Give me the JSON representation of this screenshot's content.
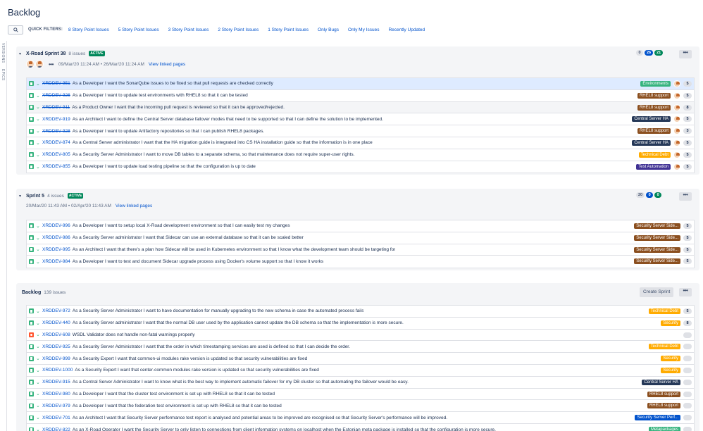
{
  "page": {
    "title": "Backlog"
  },
  "filters": {
    "label": "QUICK FILTERS:",
    "items": [
      "8 Story Point Issues",
      "5 Story Point Issues",
      "3 Story Point Issues",
      "2 Story Point Issues",
      "1 Story Point Issues",
      "Only Bugs",
      "Only My Issues",
      "Recently Updated"
    ]
  },
  "side": {
    "versions": "VERSIONS",
    "epics": "EPICS"
  },
  "colors": {
    "green": "#36b37e",
    "blue": "#0052cc",
    "teal": "#00875a",
    "brown": "#8b4f1f",
    "navy": "#253858",
    "orange": "#ffab00",
    "indigo": "#403294",
    "bug": "#ff5630"
  },
  "sprints": [
    {
      "name": "X-Road Sprint 38",
      "count": "8 issues",
      "badge": "ACTIVE",
      "dates": "09/Mar/20 11:24 AM • 26/Mar/20 11:24 AM",
      "linked": "View linked pages",
      "counts": [
        "0",
        "26",
        "21"
      ],
      "issues": [
        {
          "key": "XRDDEV-951",
          "done": true,
          "summary": "As a Developer I want the SonarQube issues to be fixed so that pull requests are checked correctly",
          "epic": "Environments",
          "epic_color": "#36b37e",
          "est": "5",
          "sel": true
        },
        {
          "key": "XRDDEV-926",
          "done": true,
          "summary": "As a Developer I want to update test environments with RHEL8 so that it can be tested",
          "epic": "RHEL8 support",
          "epic_color": "#8b4f1f",
          "est": "5"
        },
        {
          "key": "XRDDEV-911",
          "done": true,
          "summary": "As a Product Owner I want that the incoming pull request is reviewed so that it can be approved/rejected.",
          "epic": "RHEL8 support",
          "epic_color": "#8b4f1f",
          "est": "8",
          "flag": true
        },
        {
          "key": "XRDDEV-919",
          "done": false,
          "summary": "As an Architect I want to define the Central Server database failover modes that need to be supported so that I can define the solution to be implemented.",
          "epic": "Central Server HA",
          "epic_color": "#253858",
          "est": "5"
        },
        {
          "key": "XRDDEV-928",
          "done": true,
          "summary": "As a Developer I want to update Artifactory repositories so that I can publish RHEL8 packages.",
          "epic": "RHEL8 support",
          "epic_color": "#8b4f1f",
          "est": "3"
        },
        {
          "key": "XRDDEV-874",
          "done": false,
          "summary": "As a Central Server administrator I want that the HA migration guide is integrated into CS HA installation guide so that the information is in one place",
          "epic": "Central Server HA",
          "epic_color": "#253858",
          "est": "5"
        },
        {
          "key": "XRDDEV-805",
          "done": false,
          "summary": "As a Security Server Administrator I want to move DB tables to a separate schema, so that maintenance does not require super-user rights.",
          "epic": "Technical Debt",
          "epic_color": "#ffab00",
          "est": "5"
        },
        {
          "key": "XRDDEV-855",
          "done": false,
          "summary": "As a Developer I want to update load testing pipeline so that the configuration is up to date",
          "epic": "Test Automation",
          "epic_color": "#403294",
          "est": "5"
        }
      ]
    },
    {
      "name": "Sprint 5",
      "count": "4 issues",
      "badge": "ACTIVE",
      "dates": "20/Mar/20 11:43 AM • 02/Apr/20 11:43 AM",
      "linked": "View linked pages",
      "counts": [
        "20",
        "0",
        "0"
      ],
      "issues": [
        {
          "key": "XRDDEV-996",
          "done": false,
          "summary": "As a Developer I want to setup local X-Road development environment so that I can easily test my changes",
          "epic": "Security Server Side...",
          "epic_color": "#8b4f1f",
          "est": "5"
        },
        {
          "key": "XRDDEV-986",
          "done": false,
          "summary": "As a Security Server administrator I want that Sidecar can use an external database so that it can be scaled better",
          "epic": "Security Server Side...",
          "epic_color": "#8b4f1f",
          "est": "5"
        },
        {
          "key": "XRDDEV-995",
          "done": false,
          "summary": "As an Architect I want that there's a plan how Sidecar will be used in Kubernetes environment so that I know what the development team should be targeting for",
          "epic": "Security Server Side...",
          "epic_color": "#8b4f1f",
          "est": "5"
        },
        {
          "key": "XRDDEV-984",
          "done": false,
          "summary": "As a Developer I want to test and document Sidecar upgrade process using Docker's volume support so that I know it works",
          "epic": "Security Server Side...",
          "epic_color": "#8b4f1f",
          "est": "5"
        }
      ]
    }
  ],
  "backlog": {
    "name": "Backlog",
    "count": "139 issues",
    "create": "Create Sprint",
    "issues": [
      {
        "key": "XRDDEV-972",
        "type": "story",
        "summary": "As a Security Server Administrator I want to have documentation for manually upgrading to the new schema in case the automated process fails",
        "epic": "Technical Debt",
        "epic_color": "#ffab00",
        "est": "5"
      },
      {
        "key": "XRDDEV-440",
        "type": "story",
        "summary": "As a Security Server administrator I want that the normal DB user used by the application cannot update the DB schema so that the implementation is more secure.",
        "epic": "Security",
        "epic_color": "#ffab00",
        "est": "8"
      },
      {
        "key": "XRDDEV-608",
        "type": "bug",
        "summary": "WSDL Validator does not handle non-fatal warnings properly",
        "epic": "",
        "epic_color": "",
        "est": ""
      },
      {
        "key": "XRDDEV-925",
        "type": "story",
        "summary": "As a Security Server Administrator I want that the order in which timestamping services are used is defined so that I can decide the order.",
        "epic": "Technical Debt",
        "epic_color": "#ffab00",
        "est": ""
      },
      {
        "key": "XRDDEV-999",
        "type": "story",
        "summary": "As a Security Expert I want that common-ui modules rake version is updated so that security vulnerabilities are fixed",
        "epic": "Security",
        "epic_color": "#ffab00",
        "est": ""
      },
      {
        "key": "XRDDEV-1000",
        "type": "story",
        "summary": "As a Security Expert I want that center-common modules rake version is updated so that security vulnerabilities are fixed",
        "epic": "Security",
        "epic_color": "#ffab00",
        "est": ""
      },
      {
        "key": "XRDDEV-915",
        "type": "story",
        "summary": "As a Central Server Administrator I want to know what is the best way to implement automatic failover for my DB cluster so that automating the failover would be easy.",
        "epic": "Central Server HA",
        "epic_color": "#253858",
        "est": ""
      },
      {
        "key": "XRDDEV-980",
        "type": "story",
        "summary": "As a Developer I want that the cluster test environment is set up with RHEL8 so that it can be tested",
        "epic": "RHEL8 support",
        "epic_color": "#8b4f1f",
        "est": ""
      },
      {
        "key": "XRDDEV-979",
        "type": "story",
        "summary": "As a Developer I want that the federation test environment is set up with RHEL8 so that it can be tested",
        "epic": "RHEL8 support",
        "epic_color": "#8b4f1f",
        "est": ""
      },
      {
        "key": "XRDDEV-701",
        "type": "story",
        "summary": "As an Architect I want that Security Server performance test report is analysed and potential areas to be improved are recognised so that Security Server's performance will be improved.",
        "epic": "Security Server Perf...",
        "epic_color": "#0052cc",
        "est": ""
      },
      {
        "key": "XRDDEV-822",
        "type": "story",
        "summary": "As an X-Road Operator I want the Security Server to only listen to connections from client information systems on localhost when the Estonian meta package is installed so that the configuration is more secure.",
        "epic": "Metapackages",
        "epic_color": "#36b37e",
        "est": ""
      }
    ]
  }
}
